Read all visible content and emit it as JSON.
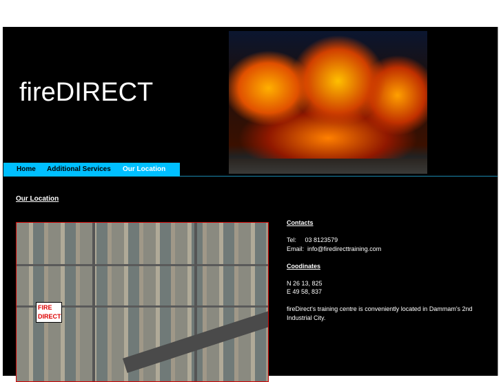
{
  "header": {
    "logo": "fireDIRECT"
  },
  "nav": {
    "items": [
      {
        "label": "Home"
      },
      {
        "label": "Additional Services"
      },
      {
        "label": "Our Location"
      }
    ],
    "active": "Our Location"
  },
  "main": {
    "title": "Our Location",
    "map_label": [
      "FIRE",
      "DIRECT"
    ],
    "contacts": {
      "heading": "Contacts",
      "tel_label": "Tel:",
      "tel": "03 8123579",
      "email_label": "Email:",
      "email": "info@firedirecttraining.com"
    },
    "coordinates": {
      "heading": "Coodinates",
      "north": "N 26 13, 825",
      "east": "E 49 58, 837"
    },
    "description": "fireDirect's training centre is conveniently located in Dammam's 2nd Industrial City."
  },
  "colors": {
    "nav": "#00bfff",
    "background": "#000000",
    "map_border": "#cc0000"
  }
}
